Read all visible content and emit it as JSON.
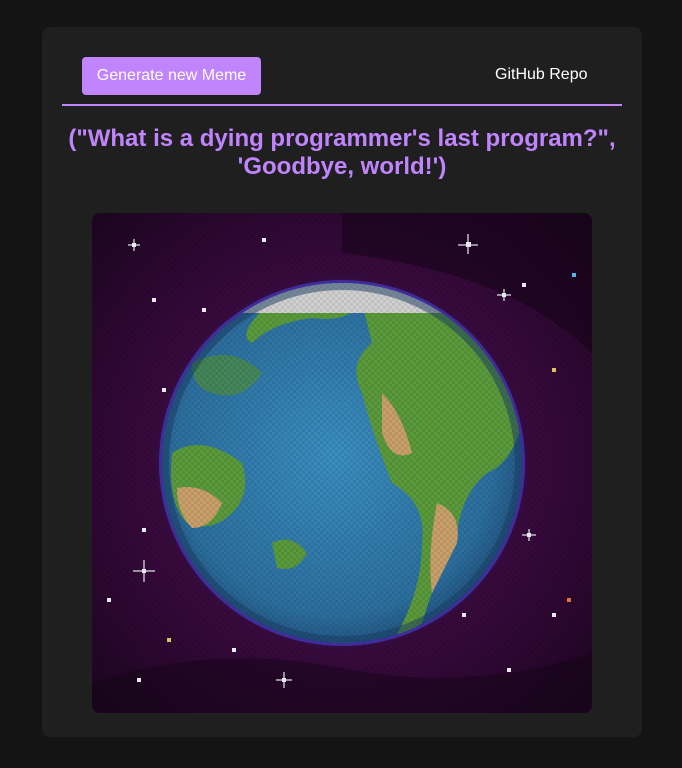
{
  "toolbar": {
    "generate_label": "Generate new Meme",
    "github_label": "GitHub Repo"
  },
  "meme": {
    "text": "(\"What is a dying programmer's last program?\", 'Goodbye, world!')"
  },
  "colors": {
    "accent": "#c084fc",
    "page_background": "#141414",
    "card_background": "#1f1f1f",
    "space": "#2b0a2e",
    "ocean": "#2e7bab",
    "land": "#5a9a3c",
    "desert": "#c9a06a",
    "ice": "#d0d0d0"
  }
}
